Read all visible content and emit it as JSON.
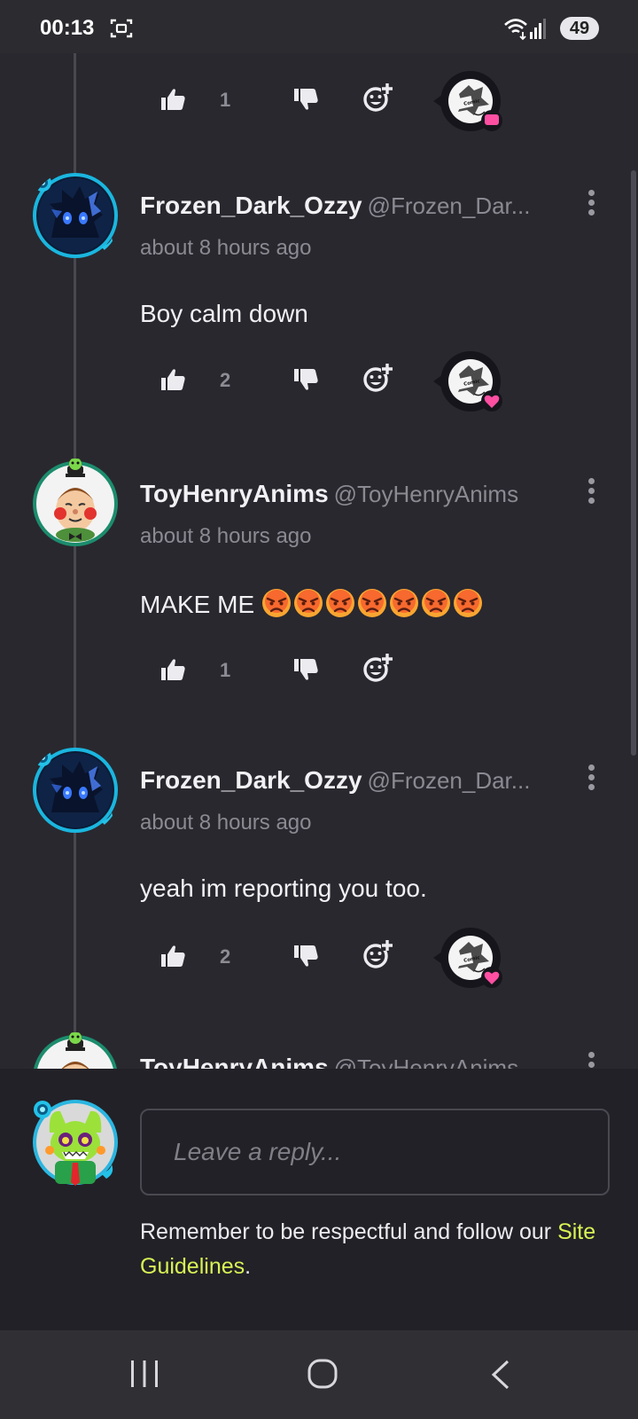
{
  "status_bar": {
    "time": "00:13",
    "battery": "49",
    "icons": [
      "screenshot-icon",
      "wifi-icon",
      "signal-icon"
    ]
  },
  "comments": [
    {
      "likes": "1",
      "reaction": "message-reaction",
      "reaction_color": "#ff4fa3"
    },
    {
      "username": "Frozen_Dark_Ozzy",
      "handle": "@Frozen_Dar...",
      "time": "about 8 hours ago",
      "text": "Boy calm down",
      "likes": "2",
      "reaction": "heart-reaction"
    },
    {
      "username": "ToyHenryAnims",
      "handle": "@ToyHenryAnims",
      "time": "about 8 hours ago",
      "text": "MAKE ME",
      "emoji_count": 7,
      "emoji": "angry-face",
      "likes": "1"
    },
    {
      "username": "Frozen_Dark_Ozzy",
      "handle": "@Frozen_Dar...",
      "time": "about 8 hours ago",
      "text": "yeah im reporting you too.",
      "likes": "2",
      "reaction": "heart-reaction"
    },
    {
      "username": "ToyHenryAnims",
      "handle": "@ToyHenryAnims"
    }
  ],
  "reply": {
    "placeholder": "Leave a reply...",
    "note": "Remember to be respectful and follow our ",
    "link": "Site Guidelines",
    "note_end": "."
  },
  "colors": {
    "background": "#29282f",
    "reply_background": "#222127",
    "link": "#d8f255",
    "heart": "#ff4fa3"
  }
}
